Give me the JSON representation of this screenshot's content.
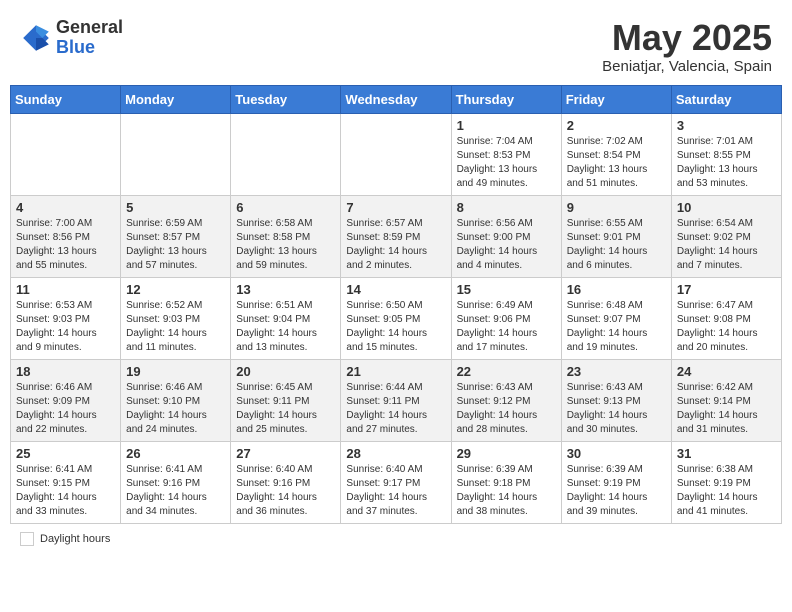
{
  "header": {
    "logo_general": "General",
    "logo_blue": "Blue",
    "month_title": "May 2025",
    "location": "Beniatjar, Valencia, Spain"
  },
  "footer": {
    "daylight_label": "Daylight hours"
  },
  "days_of_week": [
    "Sunday",
    "Monday",
    "Tuesday",
    "Wednesday",
    "Thursday",
    "Friday",
    "Saturday"
  ],
  "weeks": [
    [
      {
        "day": "",
        "info": ""
      },
      {
        "day": "",
        "info": ""
      },
      {
        "day": "",
        "info": ""
      },
      {
        "day": "",
        "info": ""
      },
      {
        "day": "1",
        "info": "Sunrise: 7:04 AM\nSunset: 8:53 PM\nDaylight: 13 hours\nand 49 minutes."
      },
      {
        "day": "2",
        "info": "Sunrise: 7:02 AM\nSunset: 8:54 PM\nDaylight: 13 hours\nand 51 minutes."
      },
      {
        "day": "3",
        "info": "Sunrise: 7:01 AM\nSunset: 8:55 PM\nDaylight: 13 hours\nand 53 minutes."
      }
    ],
    [
      {
        "day": "4",
        "info": "Sunrise: 7:00 AM\nSunset: 8:56 PM\nDaylight: 13 hours\nand 55 minutes."
      },
      {
        "day": "5",
        "info": "Sunrise: 6:59 AM\nSunset: 8:57 PM\nDaylight: 13 hours\nand 57 minutes."
      },
      {
        "day": "6",
        "info": "Sunrise: 6:58 AM\nSunset: 8:58 PM\nDaylight: 13 hours\nand 59 minutes."
      },
      {
        "day": "7",
        "info": "Sunrise: 6:57 AM\nSunset: 8:59 PM\nDaylight: 14 hours\nand 2 minutes."
      },
      {
        "day": "8",
        "info": "Sunrise: 6:56 AM\nSunset: 9:00 PM\nDaylight: 14 hours\nand 4 minutes."
      },
      {
        "day": "9",
        "info": "Sunrise: 6:55 AM\nSunset: 9:01 PM\nDaylight: 14 hours\nand 6 minutes."
      },
      {
        "day": "10",
        "info": "Sunrise: 6:54 AM\nSunset: 9:02 PM\nDaylight: 14 hours\nand 7 minutes."
      }
    ],
    [
      {
        "day": "11",
        "info": "Sunrise: 6:53 AM\nSunset: 9:03 PM\nDaylight: 14 hours\nand 9 minutes."
      },
      {
        "day": "12",
        "info": "Sunrise: 6:52 AM\nSunset: 9:03 PM\nDaylight: 14 hours\nand 11 minutes."
      },
      {
        "day": "13",
        "info": "Sunrise: 6:51 AM\nSunset: 9:04 PM\nDaylight: 14 hours\nand 13 minutes."
      },
      {
        "day": "14",
        "info": "Sunrise: 6:50 AM\nSunset: 9:05 PM\nDaylight: 14 hours\nand 15 minutes."
      },
      {
        "day": "15",
        "info": "Sunrise: 6:49 AM\nSunset: 9:06 PM\nDaylight: 14 hours\nand 17 minutes."
      },
      {
        "day": "16",
        "info": "Sunrise: 6:48 AM\nSunset: 9:07 PM\nDaylight: 14 hours\nand 19 minutes."
      },
      {
        "day": "17",
        "info": "Sunrise: 6:47 AM\nSunset: 9:08 PM\nDaylight: 14 hours\nand 20 minutes."
      }
    ],
    [
      {
        "day": "18",
        "info": "Sunrise: 6:46 AM\nSunset: 9:09 PM\nDaylight: 14 hours\nand 22 minutes."
      },
      {
        "day": "19",
        "info": "Sunrise: 6:46 AM\nSunset: 9:10 PM\nDaylight: 14 hours\nand 24 minutes."
      },
      {
        "day": "20",
        "info": "Sunrise: 6:45 AM\nSunset: 9:11 PM\nDaylight: 14 hours\nand 25 minutes."
      },
      {
        "day": "21",
        "info": "Sunrise: 6:44 AM\nSunset: 9:11 PM\nDaylight: 14 hours\nand 27 minutes."
      },
      {
        "day": "22",
        "info": "Sunrise: 6:43 AM\nSunset: 9:12 PM\nDaylight: 14 hours\nand 28 minutes."
      },
      {
        "day": "23",
        "info": "Sunrise: 6:43 AM\nSunset: 9:13 PM\nDaylight: 14 hours\nand 30 minutes."
      },
      {
        "day": "24",
        "info": "Sunrise: 6:42 AM\nSunset: 9:14 PM\nDaylight: 14 hours\nand 31 minutes."
      }
    ],
    [
      {
        "day": "25",
        "info": "Sunrise: 6:41 AM\nSunset: 9:15 PM\nDaylight: 14 hours\nand 33 minutes."
      },
      {
        "day": "26",
        "info": "Sunrise: 6:41 AM\nSunset: 9:16 PM\nDaylight: 14 hours\nand 34 minutes."
      },
      {
        "day": "27",
        "info": "Sunrise: 6:40 AM\nSunset: 9:16 PM\nDaylight: 14 hours\nand 36 minutes."
      },
      {
        "day": "28",
        "info": "Sunrise: 6:40 AM\nSunset: 9:17 PM\nDaylight: 14 hours\nand 37 minutes."
      },
      {
        "day": "29",
        "info": "Sunrise: 6:39 AM\nSunset: 9:18 PM\nDaylight: 14 hours\nand 38 minutes."
      },
      {
        "day": "30",
        "info": "Sunrise: 6:39 AM\nSunset: 9:19 PM\nDaylight: 14 hours\nand 39 minutes."
      },
      {
        "day": "31",
        "info": "Sunrise: 6:38 AM\nSunset: 9:19 PM\nDaylight: 14 hours\nand 41 minutes."
      }
    ]
  ]
}
